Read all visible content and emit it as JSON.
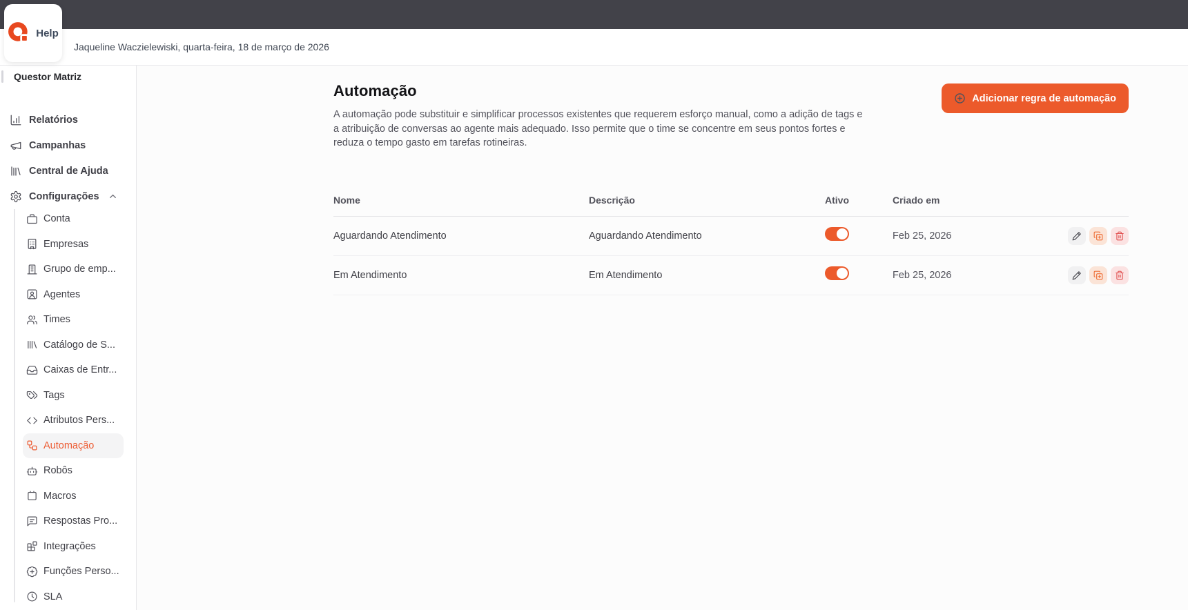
{
  "brand": {
    "logo_text": "Help",
    "accent_orange": "#EC5A2B"
  },
  "topbar": {
    "user_date_line": "Jaqueline Waczielewiski, quarta-feira, 18 de março de 2026"
  },
  "sidebar": {
    "account_name": "Questor Matriz",
    "top_items": [
      {
        "label": "Relatórios",
        "icon": "chart-icon"
      },
      {
        "label": "Campanhas",
        "icon": "megaphone-icon"
      },
      {
        "label": "Central de Ajuda",
        "icon": "help-center-icon"
      },
      {
        "label": "Configurações",
        "icon": "gear-icon",
        "expanded": true
      }
    ],
    "settings_items": [
      {
        "label": "Conta",
        "icon": "briefcase-icon"
      },
      {
        "label": "Empresas",
        "icon": "building-icon"
      },
      {
        "label": "Grupo de emp...",
        "icon": "buildings-icon"
      },
      {
        "label": "Agentes",
        "icon": "agent-badge-icon"
      },
      {
        "label": "Times",
        "icon": "users-icon"
      },
      {
        "label": "Catálogo de S...",
        "icon": "catalog-icon"
      },
      {
        "label": "Caixas de Entr...",
        "icon": "inbox-icon"
      },
      {
        "label": "Tags",
        "icon": "tags-icon"
      },
      {
        "label": "Atributos Pers...",
        "icon": "code-icon"
      },
      {
        "label": "Automação",
        "icon": "workflow-icon"
      },
      {
        "label": "Robôs",
        "icon": "bot-icon"
      },
      {
        "label": "Macros",
        "icon": "macro-icon"
      },
      {
        "label": "Respostas Pro...",
        "icon": "chat-text-icon"
      },
      {
        "label": "Integrações",
        "icon": "blocks-icon"
      },
      {
        "label": "Funções Perso...",
        "icon": "badge-plus-icon"
      },
      {
        "label": "SLA",
        "icon": "clock-icon"
      }
    ],
    "active_item": "Automação"
  },
  "main": {
    "title": "Automação",
    "description": "A automação pode substituir e simplificar processos existentes que requerem esforço manual, como a adição de tags e a atribuição de conversas ao agente mais adequado. Isso permite que o time se concentre em seus pontos fortes e reduza o tempo gasto em tarefas rotineiras.",
    "add_button_label": "Adicionar regra de automação",
    "table": {
      "headers": [
        "Nome",
        "Descrição",
        "Ativo",
        "Criado em"
      ],
      "rows": [
        {
          "name": "Aguardando Atendimento",
          "description": "Aguardando Atendimento",
          "active": true,
          "created_at": "Feb 25, 2026"
        },
        {
          "name": "Em Atendimento",
          "description": "Em Atendimento",
          "active": true,
          "created_at": "Feb 25, 2026"
        }
      ]
    }
  }
}
